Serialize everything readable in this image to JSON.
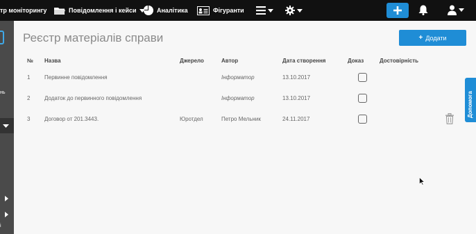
{
  "topbar": {
    "brand": "тр моніторингу",
    "nav": [
      {
        "label": "Повідомлення і кейси",
        "icon": "folder-icon"
      },
      {
        "label": "Аналітика",
        "icon": "pie-chart-icon"
      },
      {
        "label": "Фігуранти",
        "icon": "id-card-icon"
      }
    ],
    "menu_icon": "hamburger-icon",
    "settings_icon": "gear-icon",
    "add_icon": "plus-icon",
    "notifications_icon": "bell-icon",
    "user_icon": "user-icon"
  },
  "sidebar": {
    "fragment_text": "нь",
    "fragment_i": "і"
  },
  "page": {
    "title": "Реєстр матеріалів справи",
    "add_button": "Додати"
  },
  "table": {
    "headers": [
      "№",
      "Назва",
      "Джерело",
      "Автор",
      "Дата створення",
      "Доказ",
      "Достовірність"
    ],
    "rows": [
      {
        "num": "1",
        "name": "Первинне повідомлення",
        "source": "",
        "author": "Інформатор",
        "date": "13.10.2017"
      },
      {
        "num": "2",
        "name": "Додаток до первинного повідомлення",
        "source": "",
        "author": "Інформатор",
        "date": "13.10.2017"
      },
      {
        "num": "3",
        "name": "Договор от 201.3443.",
        "source": "Юротдел",
        "author": "Петро Мельник",
        "date": "24.11.2017"
      }
    ]
  },
  "help_tab": "Допомога",
  "colors": {
    "accent": "#1f8dd6",
    "topbar": "#111111",
    "sidebar": "#4a4a4a"
  }
}
